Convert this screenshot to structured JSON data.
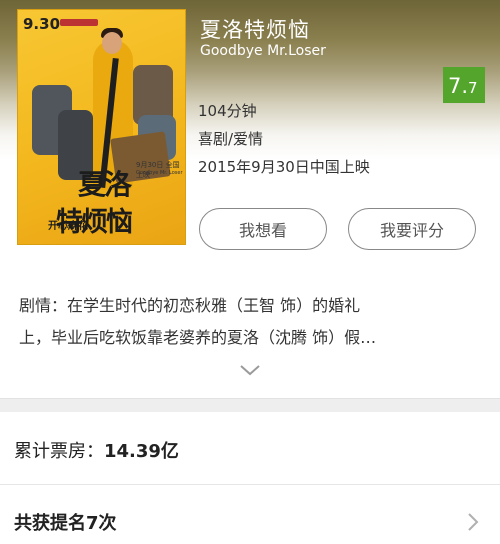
{
  "movie": {
    "title_cn": "夏洛特烦恼",
    "title_en": "Goodbye Mr.Loser",
    "rating_main": "7.",
    "rating_decimal": "7",
    "duration": "104分钟",
    "genre": "喜剧/爱情",
    "release": "2015年9月30日中国上映"
  },
  "poster": {
    "date": "9.30",
    "title_line1": "夏洛",
    "title_line2": "特烦恼",
    "tagline": "开心麻花",
    "subtitle_en": "Goodbye Mr. Loser",
    "detail": "9月30日 全国上映"
  },
  "actions": {
    "want_label": "我想看",
    "rate_label": "我要评分"
  },
  "plot": {
    "line1": "剧情：在学生时代的初恋秋雅（王智 饰）的婚礼",
    "line2": "上，毕业后吃软饭靠老婆养的夏洛（沈腾 饰）假…"
  },
  "box_office": {
    "label": "累计票房：",
    "value": "14.39亿"
  },
  "nominations": {
    "label": "共获提名7次"
  },
  "icons": {
    "expand": "chevron-down-icon",
    "nominations": "chevron-right-icon"
  },
  "colors": {
    "rating_bg": "#53a52b",
    "header_bg": "#8a7f4e"
  }
}
